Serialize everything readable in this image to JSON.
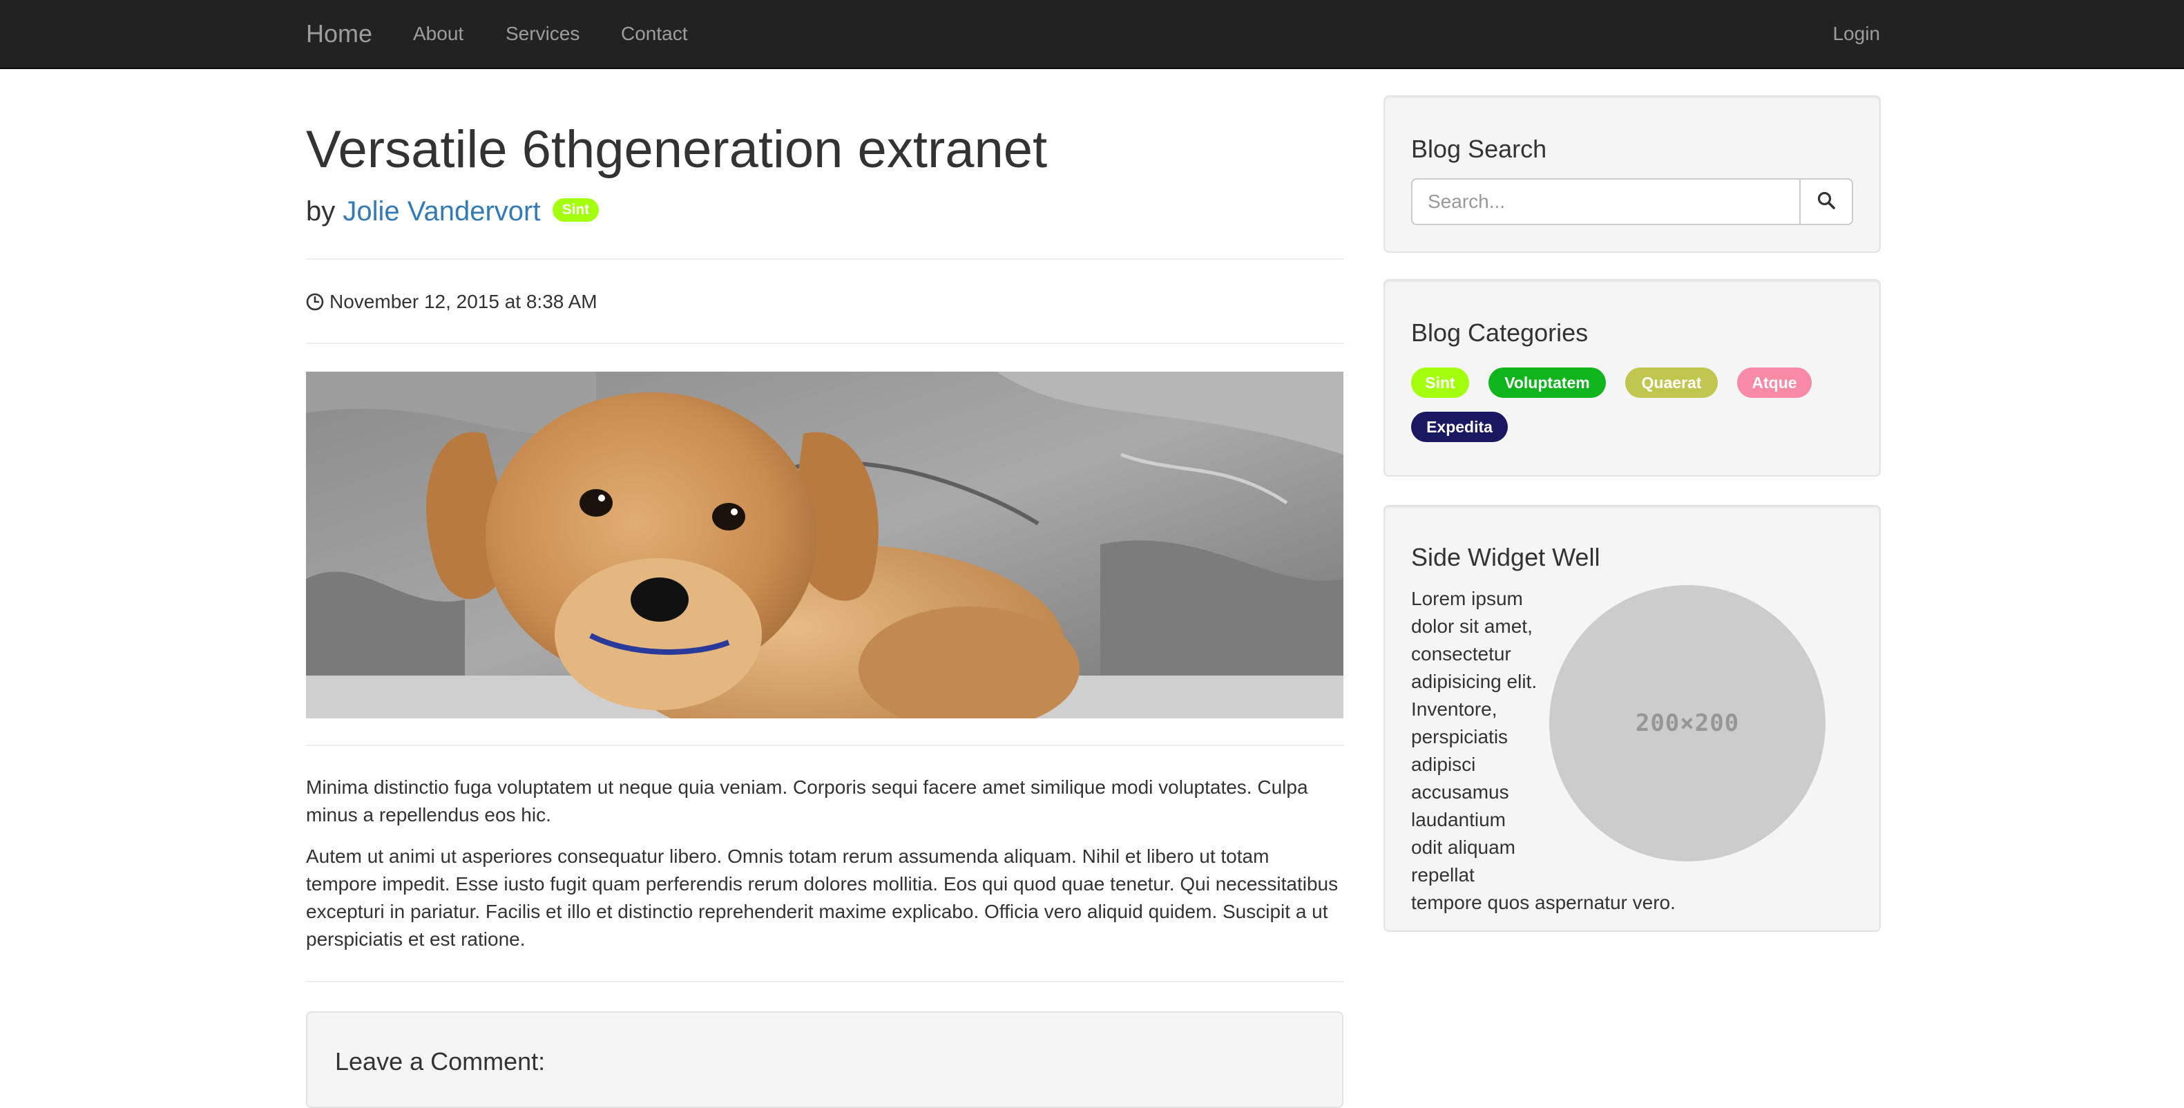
{
  "navbar": {
    "brand": "Home",
    "links": [
      "About",
      "Services",
      "Contact"
    ],
    "login": "Login",
    "background": "#222222",
    "link_color": "#9d9d9d"
  },
  "post": {
    "title": "Versatile 6thgeneration extranet",
    "by_prefix": "by",
    "author": "Jolie Vandervort",
    "tag": "Sint",
    "tag_color": "#a3ff0e",
    "date_icon": "clock-icon",
    "date": "November 12, 2015 at 8:38 AM",
    "image": "puppy-photo",
    "paragraphs": [
      "Minima distinctio fuga voluptatem ut neque quia veniam. Corporis sequi facere amet similique modi voluptates. Culpa minus a repellendus eos hic.",
      "Autem ut animi ut asperiores consequatur libero. Omnis totam rerum assumenda aliquam. Nihil et libero ut totam tempore impedit. Esse iusto fugit quam perferendis rerum dolores mollitia. Eos qui quod quae tenetur. Qui necessitatibus excepturi in pariatur. Facilis et illo et distinctio reprehenderit maxime explicabo. Officia vero aliquid quidem. Suscipit a ut perspiciatis et est ratione."
    ],
    "comment_title": "Leave a Comment:"
  },
  "sidebar": {
    "search": {
      "title": "Blog Search",
      "placeholder": "Search...",
      "button_icon": "search-icon"
    },
    "categories": {
      "title": "Blog Categories",
      "items": [
        {
          "label": "Sint",
          "color": "#a3ff0e"
        },
        {
          "label": "Voluptatem",
          "color": "#10b51d"
        },
        {
          "label": "Quaerat",
          "color": "#c1c64f"
        },
        {
          "label": "Atque",
          "color": "#f98aa6"
        },
        {
          "label": "Expedita",
          "color": "#1a1861"
        }
      ]
    },
    "widget": {
      "title": "Side Widget Well",
      "placeholder_image_label": "200×200",
      "text": "Lorem ipsum dolor sit amet, consectetur adipisicing elit. Inventore, perspiciatis adipisci accusamus laudantium odit aliquam repellat tempore quos aspernatur vero."
    }
  }
}
